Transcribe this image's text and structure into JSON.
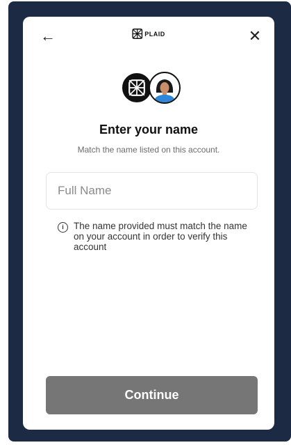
{
  "header": {
    "back_icon": "←",
    "close_icon": "✕",
    "brand": "PLAID"
  },
  "form": {
    "title": "Enter your name",
    "subtitle": "Match the name listed on this account.",
    "name_placeholder": "Full Name",
    "name_value": "",
    "hint_icon": "i",
    "hint": "The name provided must match the name on your account in order to verify this account",
    "continue_label": "Continue"
  },
  "colors": {
    "backdrop": "#1c2a44",
    "button": "#767676"
  }
}
